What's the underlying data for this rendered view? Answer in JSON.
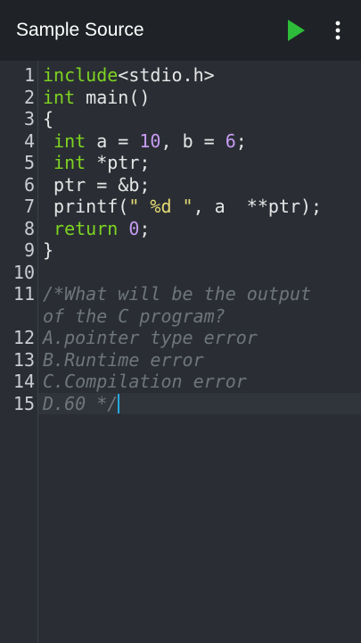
{
  "app_bar": {
    "title": "Sample Source",
    "run_icon": "play-icon",
    "menu_icon": "more-vert-icon",
    "colors": {
      "background": "#1f2327",
      "run": "#2ebd3a"
    }
  },
  "editor": {
    "colors": {
      "background": "#2a2e34",
      "keyword": "#7ed321",
      "number": "#c79bf2",
      "string": "#e6db74",
      "comment": "#6f757d",
      "cursor": "#27a8e0"
    },
    "lines": [
      {
        "num": "1",
        "tokens": [
          {
            "t": "include",
            "c": "kw"
          },
          {
            "t": "<stdio.h>",
            "c": ""
          }
        ]
      },
      {
        "num": "2",
        "tokens": [
          {
            "t": "int",
            "c": "kw"
          },
          {
            "t": " main()",
            "c": ""
          }
        ]
      },
      {
        "num": "3",
        "tokens": [
          {
            "t": "{",
            "c": ""
          }
        ]
      },
      {
        "num": "4",
        "tokens": [
          {
            "t": " ",
            "c": ""
          },
          {
            "t": "int",
            "c": "kw"
          },
          {
            "t": " a = ",
            "c": ""
          },
          {
            "t": "10",
            "c": "num"
          },
          {
            "t": ", b = ",
            "c": ""
          },
          {
            "t": "6",
            "c": "num"
          },
          {
            "t": ";",
            "c": ""
          }
        ]
      },
      {
        "num": "5",
        "tokens": [
          {
            "t": " ",
            "c": ""
          },
          {
            "t": "int",
            "c": "kw"
          },
          {
            "t": " *ptr;",
            "c": ""
          }
        ]
      },
      {
        "num": "6",
        "tokens": [
          {
            "t": " ptr = &b;",
            "c": ""
          }
        ]
      },
      {
        "num": "7",
        "tokens": [
          {
            "t": " printf(",
            "c": ""
          },
          {
            "t": "\" %d \"",
            "c": "str"
          },
          {
            "t": ", a  **ptr);",
            "c": ""
          }
        ]
      },
      {
        "num": "8",
        "tokens": [
          {
            "t": " ",
            "c": ""
          },
          {
            "t": "return",
            "c": "kw"
          },
          {
            "t": " ",
            "c": ""
          },
          {
            "t": "0",
            "c": "num"
          },
          {
            "t": ";",
            "c": ""
          }
        ]
      },
      {
        "num": "9",
        "tokens": [
          {
            "t": "}",
            "c": ""
          }
        ]
      },
      {
        "num": "10",
        "tokens": []
      },
      {
        "num": "11",
        "tokens": [
          {
            "t": "/*What will be the output",
            "c": "comment"
          }
        ],
        "wrap": [
          {
            "t": "of the C program?",
            "c": "comment"
          }
        ]
      },
      {
        "num": "12",
        "tokens": [
          {
            "t": "A.pointer type error",
            "c": "comment"
          }
        ]
      },
      {
        "num": "13",
        "tokens": [
          {
            "t": "B.Runtime error",
            "c": "comment"
          }
        ]
      },
      {
        "num": "14",
        "tokens": [
          {
            "t": "C.Compilation error",
            "c": "comment"
          }
        ]
      },
      {
        "num": "15",
        "tokens": [
          {
            "t": "D.60 */",
            "c": "comment"
          }
        ],
        "cursor": true
      }
    ]
  }
}
